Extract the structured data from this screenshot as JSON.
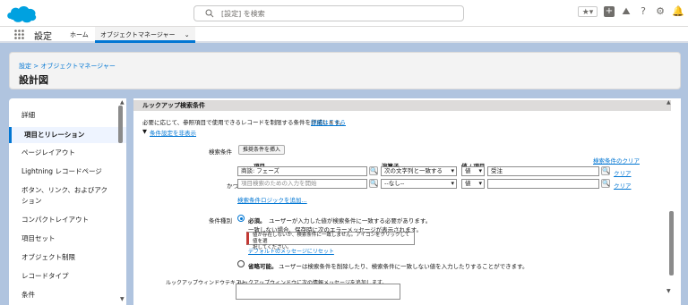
{
  "header": {
    "search_placeholder": "[設定] を検索"
  },
  "nav": {
    "app_name": "設定",
    "tabs": [
      {
        "label": "ホーム"
      },
      {
        "label": "オブジェクトマネージャー"
      }
    ]
  },
  "page_header": {
    "breadcrumb": "設定 > オブジェクトマネージャー",
    "title": "設計図"
  },
  "sidebar": {
    "items": [
      {
        "label": "詳細"
      },
      {
        "label": "項目とリレーション"
      },
      {
        "label": "ページレイアウト"
      },
      {
        "label": "Lightning レコードページ"
      },
      {
        "label": "ボタン、リンク、およびアク"
      },
      {
        "label": "ション"
      },
      {
        "label": "コンパクトレイアウト"
      },
      {
        "label": "項目セット"
      },
      {
        "label": "オブジェクト制限"
      },
      {
        "label": "レコードタイプ"
      },
      {
        "label": "条件"
      }
    ]
  },
  "main": {
    "section_title": "ルックアップ検索条件",
    "description": "必要に応じて、参照項目で使用できるレコードを制限する条件を作成します。",
    "more_link": "詳細はこちら",
    "toggle_link": "条件設定を非表示",
    "criteria_label": "検索条件",
    "insert_button": "推奨条件を挿入",
    "clear_all": "検索条件のクリア",
    "col_field": "項目",
    "col_operator": "演算子",
    "col_value": "値 / 項目",
    "row1_field": "商談: フェーズ",
    "row1_operator": "次の文字列と一致する",
    "row1_valtype": "値",
    "row1_value": "受注",
    "row1_clear": "クリア",
    "and_label": "かつ",
    "row2_field_placeholder": "項目検索のための入力を開始",
    "row2_operator": "--なし--",
    "row2_valtype": "値",
    "row2_value": "",
    "row2_clear": "クリア",
    "add_logic": "検索条件ロジックを追加...",
    "filter_type_label": "条件種別",
    "required_bold": "必須。",
    "required_text": "ユーザーが入力した値が検索条件に一致する必要があります。",
    "mismatch_text": "一致しない場合、保存時に次のエラーメッセージが表示されます。",
    "error_line1": "値が存在しないか、検索条件に一致しません。アイコンをクリックして値を選",
    "error_line2": "択してください。",
    "reset_default": "デフォルトのメッセージにリセット",
    "optional_bold": "省略可能。",
    "optional_text": "ユーザーは検索条件を削除したり、検索条件に一致しない値を入力したりすることができます。",
    "lookup_window_label": "ルックアップウィンドウテキスト",
    "lookup_window_text": "ルックアップウィンドウに次の情報メッセージを追加します。"
  }
}
